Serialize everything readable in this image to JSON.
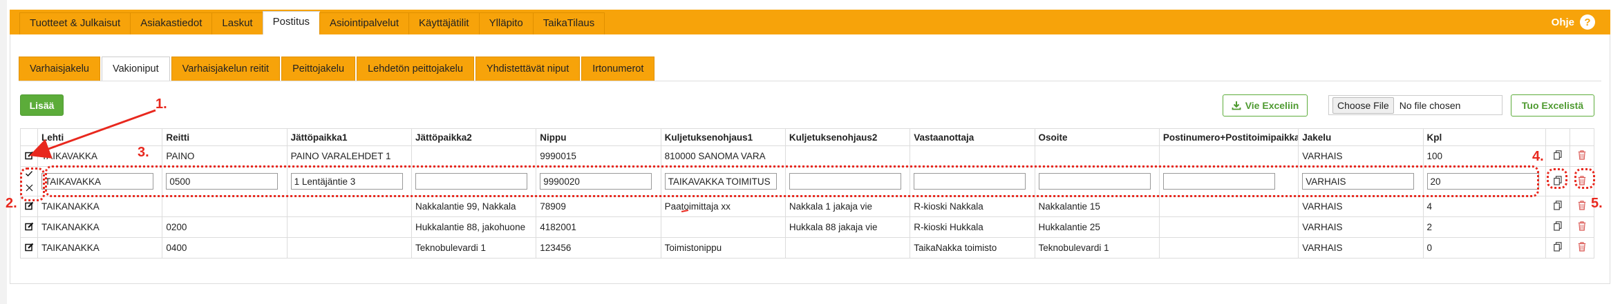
{
  "top_nav": {
    "tabs": [
      "Tuotteet & Julkaisut",
      "Asiakastiedot",
      "Laskut",
      "Postitus",
      "Asiointipalvelut",
      "Käyttäjätilit",
      "Ylläpito",
      "TaikaTilaus"
    ],
    "active_index": 3,
    "help_label": "Ohje",
    "help_icon": "?"
  },
  "sub_tabs": {
    "tabs": [
      "Varhaisjakelu",
      "Vakioniput",
      "Varhaisjakelun reitit",
      "Peittojakelu",
      "Lehdetön peittojakelu",
      "Yhdistettävät niput",
      "Irtonumerot"
    ],
    "active_index": 1
  },
  "toolbar": {
    "add_label": "Lisää",
    "export_label": "Vie Exceliin",
    "file_button_label": "Choose File",
    "file_status": "No file chosen",
    "import_label": "Tuo Excelistä"
  },
  "table": {
    "columns": [
      "Lehti",
      "Reitti",
      "Jättöpaikka1",
      "Jättöpaikka2",
      "Nippu",
      "Kuljetuksenohjaus1",
      "Kuljetuksenohjaus2",
      "Vastaanottaja",
      "Osoite",
      "Postinumero+Postitoimipaikka",
      "Jakelu",
      "Kpl"
    ],
    "rows": [
      {
        "cells": [
          "TAIKAVAKKA",
          "PAINO",
          "PAINO VARALEHDET 1",
          "",
          "9990015",
          "810000 SANOMA VARA",
          "",
          "",
          "",
          "",
          "VARHAIS",
          "100"
        ]
      },
      {
        "editing": true,
        "cells": [
          "TAIKAVAKKA",
          "0500",
          "1 Lentäjäntie 3",
          "",
          "9990020",
          "TAIKAVAKKA TOIMITUS",
          "",
          "",
          "",
          "",
          "VARHAIS",
          "20"
        ]
      },
      {
        "cells": [
          "TAIKANAKKA",
          "",
          "",
          "Nakkalantie 99, Nakkala",
          "78909",
          "Paatoimittaja xx",
          "Nakkala 1 jakaja vie",
          "R-kioski Nakkala",
          "Nakkalantie 15",
          "",
          "VARHAIS",
          "4"
        ]
      },
      {
        "cells": [
          "TAIKANAKKA",
          "0200",
          "",
          "Hukkalantie 88, jakohuone",
          "4182001",
          "",
          "Hukkala 88 jakaja vie",
          "R-kioski Hukkala",
          "Hukkalantie 25",
          "",
          "VARHAIS",
          "2"
        ]
      },
      {
        "cells": [
          "TAIKANAKKA",
          "0400",
          "",
          "Teknobulevardi 1",
          "123456",
          "Toimistonippu",
          "",
          "TaikaNakka toimisto",
          "Teknobulevardi 1",
          "",
          "VARHAIS",
          "0"
        ]
      }
    ]
  },
  "annotations": {
    "labels": [
      "1.",
      "2.",
      "3.",
      "4.",
      "5."
    ],
    "color": "#e8281e"
  },
  "colors": {
    "nav_orange": "#f7a30a",
    "green": "#5cac3a",
    "delete_red": "#d9534f"
  },
  "icons": [
    "edit-icon",
    "check-icon",
    "close-icon",
    "copy-icon",
    "trash-icon",
    "download-icon",
    "help-icon"
  ]
}
